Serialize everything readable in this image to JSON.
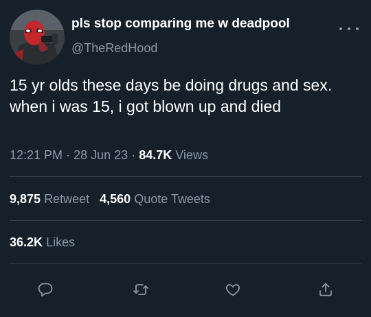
{
  "tweet": {
    "author": {
      "display_name": "pls stop comparing me w deadpool",
      "handle": "@TheRedHood"
    },
    "text": "15 yr olds these days be doing drugs and sex. when i was 15, i got blown up and died",
    "time": "12:21 PM",
    "separator": "·",
    "date": "28 Jun 23",
    "views_count": "84.7K",
    "views_label": "Views",
    "retweets_count": "9,875",
    "retweets_label": "Retweet",
    "quotes_count": "4,560",
    "quotes_label": "Quote Tweets",
    "likes_count": "36.2K",
    "likes_label": "Likes"
  },
  "icons": {
    "more": "more-horizontal-icon",
    "reply": "reply-icon",
    "retweet": "retweet-icon",
    "like": "like-icon",
    "share": "share-icon"
  },
  "colors": {
    "background": "#15202b",
    "text_primary": "#ffffff",
    "text_secondary": "#8b98a5",
    "divider": "#38444d"
  }
}
